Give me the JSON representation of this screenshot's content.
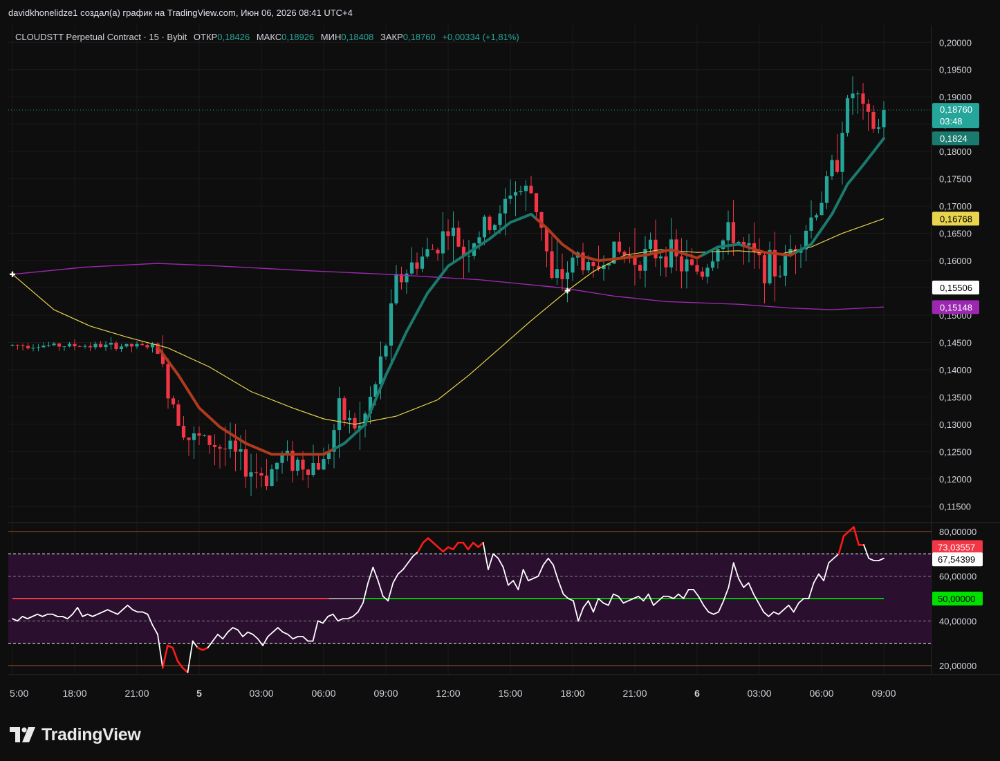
{
  "header": {
    "caption": "davidkhonelidze1 создал(а) график на TradingView.com, Июн 06, 2026 08:41 UTC+4"
  },
  "legend": {
    "symbol": "CLOUDSTT Perpetual Contract · 15 · Bybit",
    "open_label": "ОТКР",
    "open": "0,18426",
    "high_label": "МАКС",
    "high": "0,18926",
    "low_label": "МИН",
    "low": "0,18408",
    "close_label": "ЗАКР",
    "close": "0,18760",
    "change": "+0,00334 (+1,81%)"
  },
  "branding": {
    "logo_text": "TradingView"
  },
  "colors": {
    "background": "#0e0e0e",
    "up": "#26a69a",
    "down": "#f23645",
    "ema_fast_up": "#1a7a6e",
    "ema_fast_down": "#b03a1e",
    "ema_mid": "#e8d44d",
    "ema_slow": "#9c27b0",
    "rsi_line": "#ffffff",
    "rsi_band": "#2a0f2f"
  },
  "chart_data": [
    {
      "type": "candlestick",
      "symbol": "CLOUDSTT Perpetual Contract",
      "timeframe": "15",
      "exchange": "Bybit",
      "ylim": [
        0.112,
        0.2032
      ],
      "y_ticks": [
        "0,20000",
        "0,19500",
        "0,19000",
        "0,18500",
        "0,18000",
        "0,17500",
        "0,17000",
        "0,16500",
        "0,16000",
        "0,15500",
        "0,15000",
        "0,14500",
        "0,14000",
        "0,13500",
        "0,13000",
        "0,12500",
        "0,12000",
        "0,11500"
      ],
      "y_tick_values": [
        0.2,
        0.195,
        0.19,
        0.185,
        0.18,
        0.175,
        0.17,
        0.165,
        0.16,
        0.155,
        0.15,
        0.145,
        0.14,
        0.135,
        0.13,
        0.125,
        0.12,
        0.115
      ],
      "x_ticks": [
        "5:00",
        "18:00",
        "21:00",
        "5",
        "03:00",
        "06:00",
        "09:00",
        "12:00",
        "15:00",
        "18:00",
        "21:00",
        "6",
        "03:00",
        "06:00",
        "09:00"
      ],
      "x_tick_bold": [
        false,
        false,
        false,
        true,
        false,
        false,
        false,
        false,
        false,
        false,
        false,
        true,
        false,
        false,
        false
      ],
      "x_tick_bar_index": [
        0,
        12,
        24,
        36,
        48,
        60,
        72,
        84,
        96,
        108,
        120,
        132,
        144,
        156,
        168
      ],
      "x_range_bars": [
        0,
        178
      ],
      "current_price": "0,18760",
      "countdown": "03:48",
      "price_labels": [
        {
          "text": "0,1824",
          "value": 0.1824,
          "bg": "#1a7a6e",
          "fg": "#ffffff"
        },
        {
          "text": "0,16768",
          "value": 0.16768,
          "bg": "#e8d44d",
          "fg": "#000000"
        },
        {
          "text": "0,15506",
          "value": 0.15506,
          "bg": "#ffffff",
          "fg": "#000000"
        },
        {
          "text": "0,15148",
          "value": 0.15148,
          "bg": "#9c27b0",
          "fg": "#ffffff"
        }
      ],
      "anchors": [
        {
          "price": 0.1575,
          "bar": 0
        },
        {
          "price": 0.1545,
          "bar": 107
        }
      ],
      "segments": [
        [
          0,
          0.1445
        ],
        [
          28,
          0.1443
        ],
        [
          29,
          0.1395
        ],
        [
          31,
          0.134
        ],
        [
          34,
          0.1275
        ],
        [
          38,
          0.1268
        ],
        [
          42,
          0.125
        ],
        [
          45,
          0.1222
        ],
        [
          49,
          0.1205
        ],
        [
          52,
          0.124
        ],
        [
          57,
          0.1225
        ],
        [
          60,
          0.123
        ],
        [
          63,
          0.132
        ],
        [
          67,
          0.129
        ],
        [
          70,
          0.137
        ],
        [
          72,
          0.145
        ],
        [
          74,
          0.156
        ],
        [
          78,
          0.16
        ],
        [
          81,
          0.162
        ],
        [
          84,
          0.166
        ],
        [
          87,
          0.1615
        ],
        [
          91,
          0.166
        ],
        [
          94,
          0.1675
        ],
        [
          96,
          0.173
        ],
        [
          100,
          0.1725
        ],
        [
          102,
          0.167
        ],
        [
          104,
          0.156
        ],
        [
          106,
          0.157
        ],
        [
          109,
          0.161
        ],
        [
          112,
          0.1575
        ],
        [
          115,
          0.162
        ],
        [
          120,
          0.1605
        ],
        [
          126,
          0.162
        ],
        [
          129,
          0.159
        ],
        [
          133,
          0.158
        ],
        [
          136,
          0.163
        ],
        [
          139,
          0.165
        ],
        [
          141,
          0.162
        ],
        [
          144,
          0.1595
        ],
        [
          148,
          0.158
        ],
        [
          150,
          0.162
        ],
        [
          153,
          0.166
        ],
        [
          156,
          0.1715
        ],
        [
          159,
          0.179
        ],
        [
          160,
          0.185
        ],
        [
          162,
          0.191
        ],
        [
          163,
          0.1895
        ],
        [
          165,
          0.185
        ],
        [
          167,
          0.184
        ],
        [
          168,
          0.1876
        ]
      ],
      "ema_fast": [
        [
          28,
          0.1442
        ],
        [
          32,
          0.139
        ],
        [
          36,
          0.133
        ],
        [
          40,
          0.1295
        ],
        [
          45,
          0.1265
        ],
        [
          50,
          0.1245
        ],
        [
          55,
          0.1245
        ],
        [
          60,
          0.1245
        ],
        [
          64,
          0.1265
        ],
        [
          68,
          0.13
        ],
        [
          72,
          0.139
        ],
        [
          76,
          0.147
        ],
        [
          80,
          0.154
        ],
        [
          84,
          0.159
        ],
        [
          88,
          0.1615
        ],
        [
          92,
          0.164
        ],
        [
          96,
          0.167
        ],
        [
          100,
          0.1685
        ],
        [
          103,
          0.166
        ],
        [
          106,
          0.163
        ],
        [
          109,
          0.161
        ],
        [
          113,
          0.16
        ],
        [
          118,
          0.1605
        ],
        [
          122,
          0.161
        ],
        [
          127,
          0.162
        ],
        [
          132,
          0.1605
        ],
        [
          136,
          0.1625
        ],
        [
          140,
          0.163
        ],
        [
          145,
          0.1615
        ],
        [
          150,
          0.161
        ],
        [
          154,
          0.163
        ],
        [
          158,
          0.1685
        ],
        [
          161,
          0.174
        ],
        [
          164,
          0.1775
        ],
        [
          168,
          0.1824
        ]
      ],
      "ema_fast_down_ranges": [
        [
          28,
          62
        ],
        [
          101,
          133
        ],
        [
          141,
          151
        ]
      ],
      "ema_mid": [
        [
          0,
          0.1575
        ],
        [
          8,
          0.151
        ],
        [
          15,
          0.148
        ],
        [
          22,
          0.146
        ],
        [
          30,
          0.144
        ],
        [
          38,
          0.1405
        ],
        [
          46,
          0.136
        ],
        [
          54,
          0.133
        ],
        [
          60,
          0.131
        ],
        [
          66,
          0.13
        ],
        [
          74,
          0.1315
        ],
        [
          82,
          0.1345
        ],
        [
          88,
          0.139
        ],
        [
          94,
          0.144
        ],
        [
          100,
          0.149
        ],
        [
          107,
          0.1545
        ],
        [
          112,
          0.158
        ],
        [
          118,
          0.161
        ],
        [
          125,
          0.162
        ],
        [
          132,
          0.1615
        ],
        [
          140,
          0.1618
        ],
        [
          148,
          0.1612
        ],
        [
          154,
          0.1625
        ],
        [
          160,
          0.165
        ],
        [
          168,
          0.1677
        ]
      ],
      "ema_slow": [
        [
          0,
          0.1575
        ],
        [
          14,
          0.1588
        ],
        [
          28,
          0.1595
        ],
        [
          40,
          0.159
        ],
        [
          56,
          0.1582
        ],
        [
          72,
          0.1575
        ],
        [
          90,
          0.1565
        ],
        [
          106,
          0.155
        ],
        [
          116,
          0.1535
        ],
        [
          126,
          0.1525
        ],
        [
          140,
          0.152
        ],
        [
          150,
          0.1513
        ],
        [
          158,
          0.151
        ],
        [
          168,
          0.1515
        ]
      ]
    },
    {
      "type": "line",
      "name": "RSI",
      "ylim": [
        16,
        84
      ],
      "y_ticks": [
        "80,00000",
        "60,00000",
        "40,00000",
        "20,00000"
      ],
      "y_tick_values": [
        80,
        60,
        40,
        20
      ],
      "levels": {
        "outer_upper": 80,
        "overbought": 70,
        "mid_upper": 60,
        "mid_lower": 40,
        "oversold": 30,
        "outer_lower": 20
      },
      "midline": 50,
      "value_labels": [
        {
          "text": "73,03557",
          "value": 73.03557,
          "bg": "#f23645",
          "fg": "#ffffff"
        },
        {
          "text": "67,54399",
          "value": 67.54399,
          "bg": "#ffffff",
          "fg": "#000000"
        },
        {
          "text": "50,00000",
          "value": 50.0,
          "bg": "#00e000",
          "fg": "#000000"
        }
      ],
      "midline_segments": [
        {
          "from": 0,
          "to": 61,
          "color": "#f23645"
        },
        {
          "from": 61,
          "to": 68,
          "color": "#9e9e9e"
        },
        {
          "from": 68,
          "to": 168,
          "color": "#00c800"
        }
      ],
      "values": [
        41,
        40,
        42,
        41,
        42,
        43,
        42,
        43,
        43,
        42,
        42,
        41,
        43,
        46,
        42,
        43,
        42,
        43,
        44,
        45,
        44,
        43,
        45,
        47,
        45,
        44,
        44,
        43,
        38,
        34,
        19,
        29,
        28,
        22,
        19,
        17,
        31,
        28,
        27,
        28,
        31,
        34,
        32,
        35,
        37,
        36,
        33,
        35,
        34,
        32,
        29,
        33,
        35,
        37,
        35,
        34,
        32,
        33,
        33,
        31,
        31,
        40,
        39,
        42,
        43,
        40,
        41,
        41,
        42,
        44,
        48,
        57,
        64,
        58,
        51,
        49,
        57,
        61,
        63,
        66,
        69,
        71,
        75,
        77,
        75,
        73,
        71,
        73,
        72,
        75,
        75,
        72,
        75,
        73,
        75,
        63,
        70,
        68,
        64,
        56,
        58,
        54,
        63,
        58,
        59,
        60,
        65,
        68,
        65,
        58,
        52,
        50
      ],
      "values_tail": [
        49,
        40,
        46,
        49,
        44,
        50,
        48,
        47,
        52,
        51,
        48,
        49,
        50,
        51,
        49,
        52,
        47,
        49,
        51,
        51,
        50,
        52,
        50,
        54,
        54,
        51,
        47,
        44,
        43,
        44,
        49,
        55,
        66,
        59,
        55,
        57,
        52,
        48,
        44,
        42,
        44,
        43,
        45,
        47,
        44,
        48,
        50,
        50,
        57,
        61,
        58,
        66,
        68,
        70,
        78,
        80,
        82,
        74,
        74,
        68,
        67,
        67,
        68
      ]
    }
  ]
}
